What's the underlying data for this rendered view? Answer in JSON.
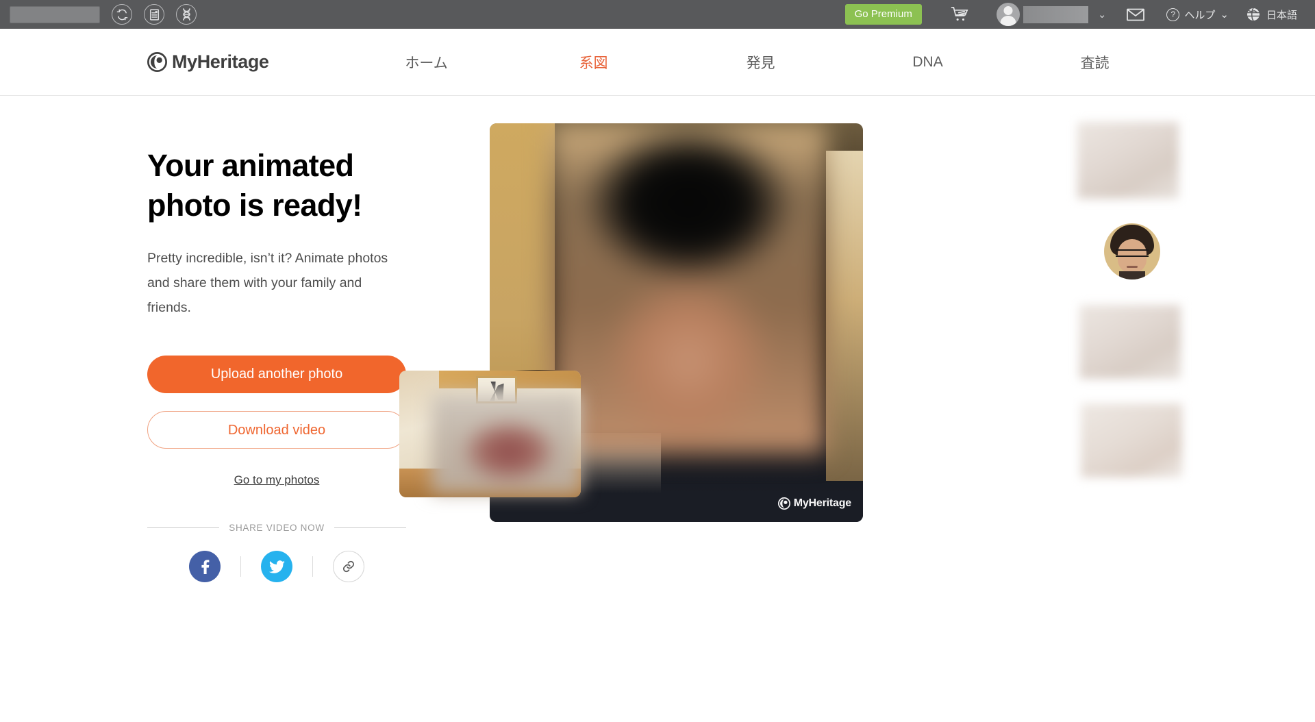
{
  "toolbar": {
    "search_placeholder": "",
    "search_value": "",
    "icons": [
      "sync-icon",
      "records-icon",
      "dna-icon"
    ],
    "go_premium_label": "Go Premium",
    "cart_icon": "cart-icon",
    "avatar_icon": "user-avatar-icon",
    "username": "",
    "caret_glyph": "⌄",
    "mail_icon": "mail-icon",
    "help_label": "ヘルプ",
    "help_caret_glyph": "⌄",
    "help_icon": "question-mark-icon",
    "language_icon": "globe-icon",
    "language_label": "日本語"
  },
  "sitenav": {
    "brand": "MyHeritage",
    "brand_icon": "myheritage-logo-icon",
    "items": [
      {
        "label": "ホーム",
        "active": false
      },
      {
        "label": "系図",
        "active": true
      },
      {
        "label": "発見",
        "active": false
      },
      {
        "label": "DNA",
        "active": false
      },
      {
        "label": "査読",
        "active": false
      }
    ]
  },
  "main": {
    "headline": "Your animated photo is ready!",
    "subtext": "Pretty incredible, isn’t it? Animate photos and share them with your family and friends.",
    "upload_button": "Upload another photo",
    "download_button": "Download video",
    "photos_link": "Go to my photos",
    "share_heading": "SHARE VIDEO NOW",
    "share_buttons": [
      {
        "name": "facebook-share-button",
        "icon": "facebook-icon"
      },
      {
        "name": "twitter-share-button",
        "icon": "twitter-icon"
      },
      {
        "name": "copy-link-button",
        "icon": "link-icon"
      }
    ]
  },
  "video": {
    "watermark": "MyHeritage",
    "watermark_icon": "myheritage-logo-icon"
  },
  "rail": {
    "thumbnails": [
      {
        "name": "photo-thumbnail-1",
        "type": "rect"
      },
      {
        "name": "photo-thumbnail-2",
        "type": "circle-portrait"
      },
      {
        "name": "photo-thumbnail-3",
        "type": "rect"
      },
      {
        "name": "photo-thumbnail-4",
        "type": "rect"
      }
    ]
  },
  "colors": {
    "toolbar_bg": "#58595b",
    "premium_green": "#8cc152",
    "accent_orange": "#f1662c",
    "accent_orange_text": "#ef6630",
    "facebook_blue": "#4460a7",
    "twitter_blue": "#26b2ee",
    "page_bg": "#ffffff"
  }
}
